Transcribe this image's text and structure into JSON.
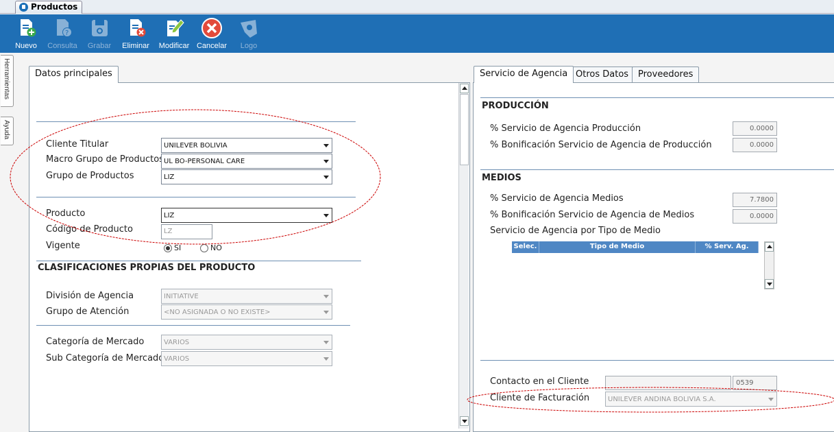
{
  "document_tab": {
    "label": "Productos"
  },
  "toolbar": {
    "buttons": [
      {
        "label": "Nuevo",
        "icon": "new-document-icon",
        "enabled": true
      },
      {
        "label": "Consulta",
        "icon": "query-document-icon",
        "enabled": false
      },
      {
        "label": "Grabar",
        "icon": "save-disk-icon",
        "enabled": false
      },
      {
        "label": "Eliminar",
        "icon": "delete-document-icon",
        "enabled": true
      },
      {
        "label": "Modificar",
        "icon": "edit-document-icon",
        "enabled": true
      },
      {
        "label": "Cancelar",
        "icon": "cancel-circle-icon",
        "enabled": true
      },
      {
        "label": "Logo",
        "icon": "logo-icon",
        "enabled": false
      }
    ]
  },
  "side_tabs": [
    "Herramientas",
    "Ayuda"
  ],
  "left_panel": {
    "tab": "Datos principales",
    "fields": {
      "cliente_titular": {
        "label": "Cliente Titular",
        "value": "UNILEVER BOLIVIA"
      },
      "macro_grupo": {
        "label": "Macro Grupo de Productos",
        "value": "UL BO-PERSONAL CARE"
      },
      "grupo": {
        "label": "Grupo de Productos",
        "value": "LIZ"
      },
      "producto": {
        "label": "Producto",
        "value": "LIZ"
      },
      "codigo": {
        "label": "Código de Producto",
        "value": "LZ"
      },
      "vigente": {
        "label": "Vigente",
        "option_si": "SI",
        "option_no": "NO",
        "selected": "SI"
      }
    },
    "clasificaciones": {
      "title": "CLASIFICACIONES PROPIAS DEL PRODUCTO",
      "division": {
        "label": "División de Agencia",
        "value": "INITIATIVE"
      },
      "grupo_atencion": {
        "label": "Grupo de Atención",
        "value": "<NO ASIGNADA O NO EXISTE>"
      },
      "categoria": {
        "label": "Categoría de Mercado",
        "value": "VARIOS"
      },
      "sub_categoria": {
        "label": "Sub Categoría de Mercado",
        "value": "VARIOS"
      }
    }
  },
  "right_panel": {
    "tabs": [
      "Servicio de Agencia",
      "Otros Datos",
      "Proveedores"
    ],
    "active_tab": "Servicio de Agencia",
    "produccion": {
      "title": "PRODUCCIÓN",
      "servicio": {
        "label": "% Servicio de Agencia Producción",
        "value": "0.0000"
      },
      "bonificacion": {
        "label": "% Bonificación Servicio de Agencia de Producción",
        "value": "0.0000"
      }
    },
    "medios": {
      "title": "MEDIOS",
      "servicio": {
        "label": "% Servicio de Agencia Medios",
        "value": "7.7800"
      },
      "bonificacion": {
        "label": "% Bonificación Servicio de Agencia de Medios",
        "value": "0.0000"
      },
      "por_tipo_label": "Servicio de Agencia por Tipo de Medio",
      "grid_columns": [
        "Selec.",
        "Tipo de Medio",
        "% Serv. Ag."
      ]
    },
    "contacto": {
      "label": "Contacto en el Cliente",
      "value": "",
      "code": "0539"
    },
    "facturacion": {
      "label": "Cliente de Facturación",
      "value": "UNILEVER ANDINA BOLIVIA S.A."
    }
  },
  "colors": {
    "toolbar": "#1f6fb5",
    "annotation": "#cc0000",
    "grid_header": "#4f87c4"
  }
}
